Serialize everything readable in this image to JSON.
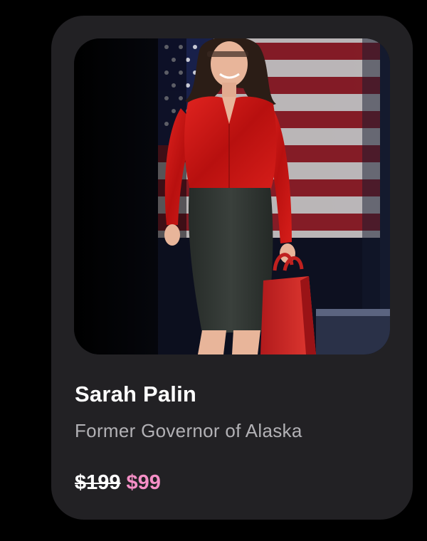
{
  "card": {
    "name": "Sarah Palin",
    "subtitle": "Former Governor of Alaska",
    "price": {
      "original": "$199",
      "sale": "$99"
    }
  },
  "colors": {
    "page_background": "#000000",
    "card_background": "#222124",
    "name_text": "#ffffff",
    "subtitle_text": "#b2b1b5",
    "sale_price": "#f58fc6",
    "flag_red": "#8e1d26",
    "blouse_red": "#c8161a",
    "skirt": "#2f3430"
  },
  "icons": {
    "photo": "portrait-photo"
  }
}
